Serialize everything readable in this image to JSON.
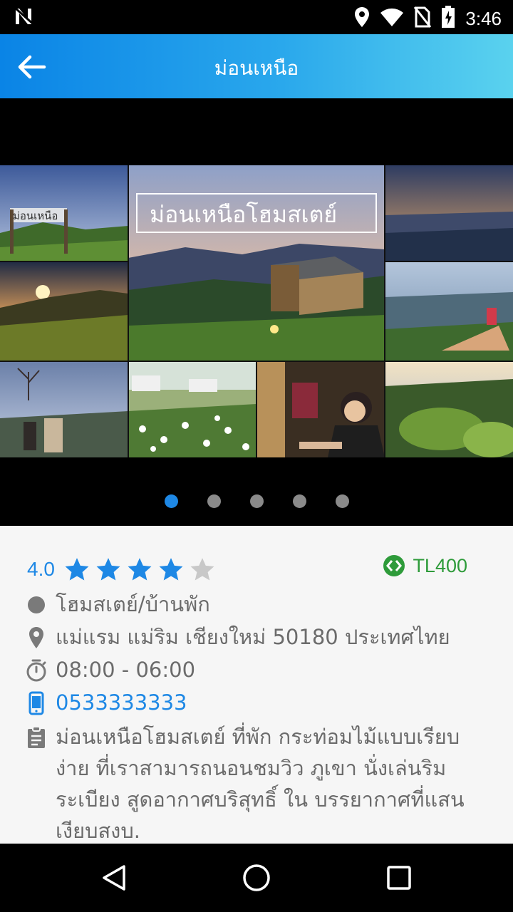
{
  "status_bar": {
    "time": "3:46"
  },
  "app_bar": {
    "title": "ม่อนเหนือ"
  },
  "gallery": {
    "logo_text": "ม่อนเหนือโฮมสเตย์",
    "sign_text": "ม่อนเหนือ",
    "dots_count": 5,
    "active_index": 0
  },
  "details": {
    "rating_value": "4.0",
    "stars_filled": 4,
    "stars_total": 5,
    "price_label": "TL400",
    "category": "โฮมสเตย์/บ้านพัก",
    "address": "แม่แรม แม่ริม เชียงใหม่ 50180 ประเทศไทย",
    "hours": "08:00 - 06:00",
    "phone": "0533333333",
    "description": "ม่อนเหนือโฮมสเตย์ ที่พัก กระท่อมไม้แบบเรียบง่าย ที่เราสามารถนอนชมวิว ภูเขา นั่งเล่นริมระเบียง สูดอากาศบริสุทธิ์ ใน บรรยากาศที่แสนเงียบสงบ."
  },
  "colors": {
    "accent": "#1e88e5",
    "price": "#2e9b3a",
    "text": "#6b6b6b"
  }
}
